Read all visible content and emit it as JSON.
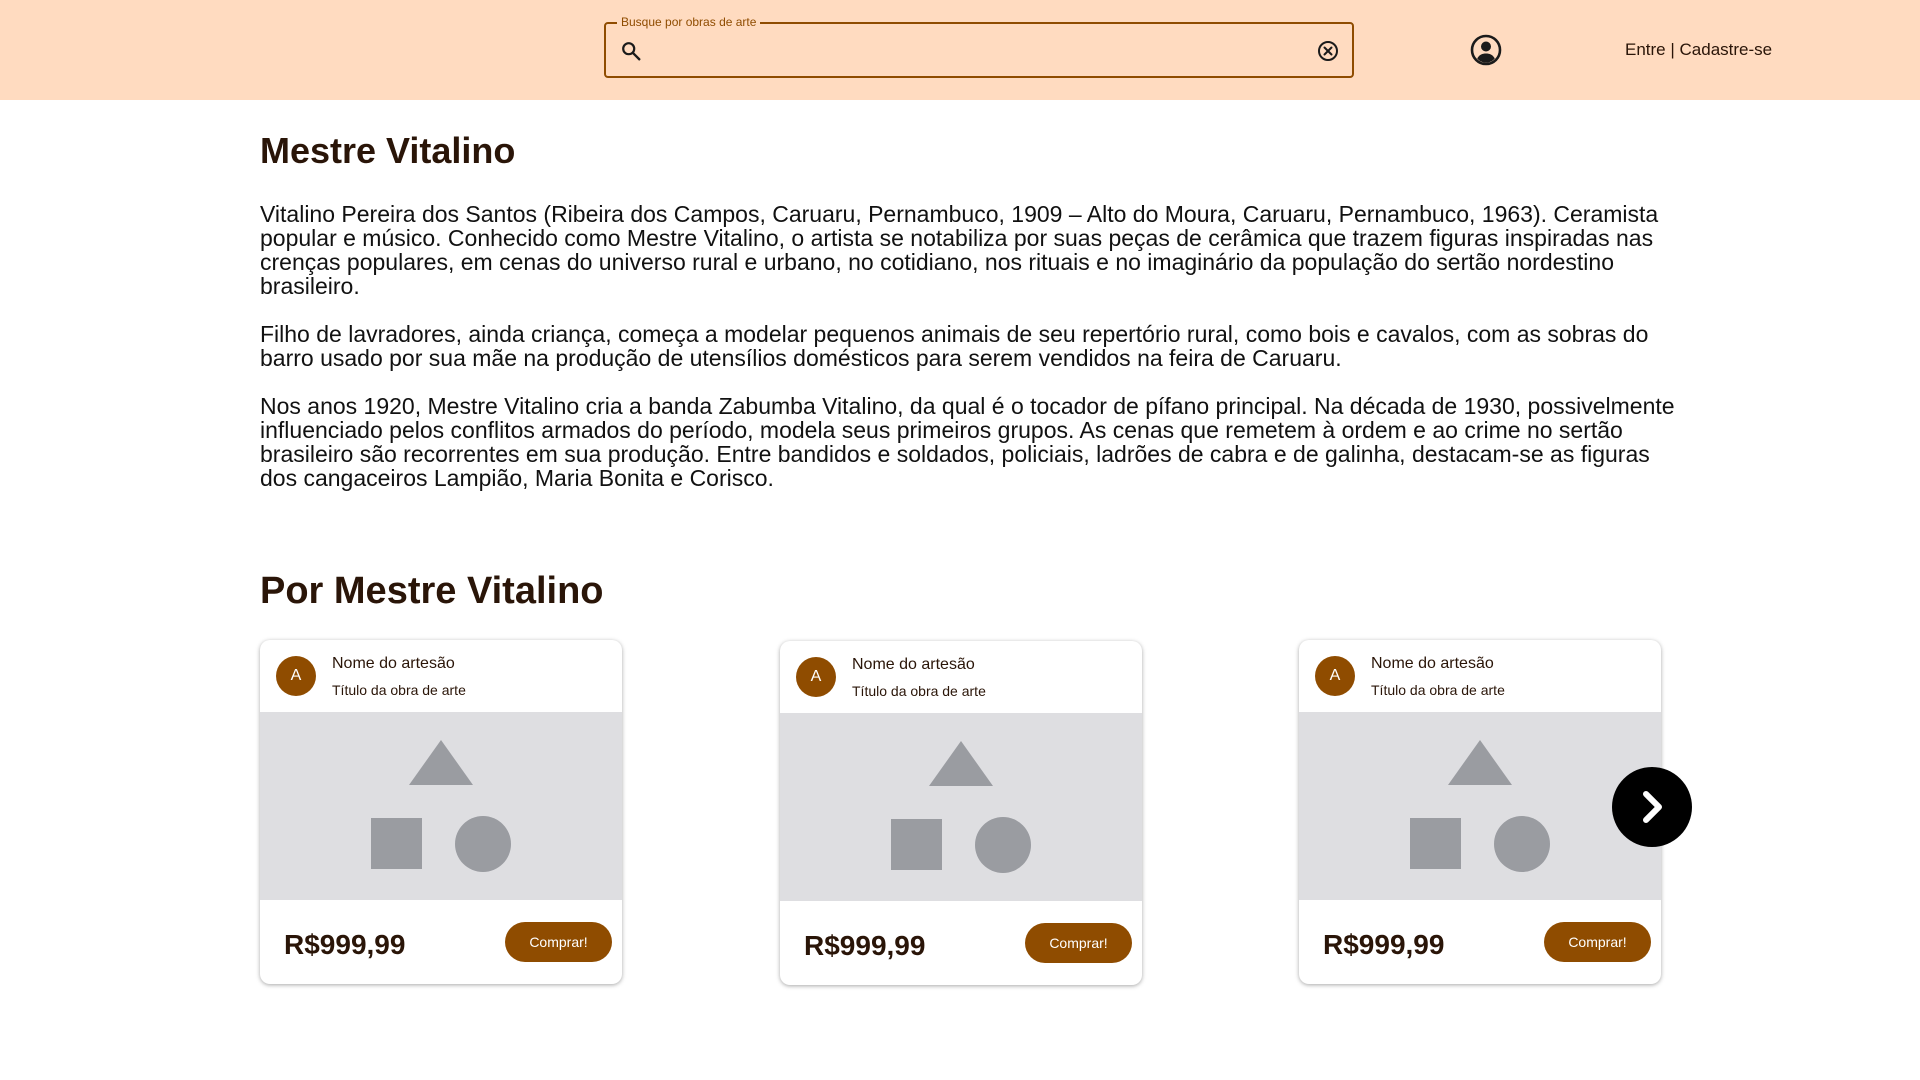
{
  "header": {
    "search": {
      "label": "Busque por obras de arte",
      "value": ""
    },
    "auth": {
      "login": "Entre",
      "separator": "|",
      "signup": "Cadastre-se"
    }
  },
  "artist": {
    "name": "Mestre Vitalino",
    "bio": [
      "Vitalino Pereira dos Santos (Ribeira dos Campos, Caruaru, Pernambuco, 1909 – Alto do Moura, Caruaru, Pernambuco, 1963). Ceramista popular e músico. Conhecido como Mestre Vitalino, o artista se notabiliza por suas peças de cerâmica que trazem figuras inspiradas nas crenças populares, em cenas do universo rural e urbano, no cotidiano, nos rituais e no imaginário da população do sertão nordestino brasileiro.",
      "Filho de lavradores, ainda criança, começa a modelar pequenos animais de seu repertório rural, como bois e cavalos, com as sobras do barro usado por sua mãe na produção de utensílios domésticos para serem vendidos na feira de Caruaru.",
      "Nos anos 1920, Mestre Vitalino cria a banda Zabumba Vitalino, da qual é o tocador de pífano principal. Na década de 1930, possivelmente influenciado pelos conflitos armados do período, modela seus primeiros grupos. As cenas que remetem à ordem e ao crime no sertão brasileiro são recorrentes em sua produção. Entre bandidos e soldados, policiais, ladrões de cabra e de galinha, destacam-se as figuras dos cangaceiros Lampião, Maria Bonita e Corisco."
    ]
  },
  "works_section": {
    "title": "Por Mestre Vitalino",
    "cards": [
      {
        "avatar": "A",
        "artisan": "Nome do artesão",
        "title": "Título da obra de arte",
        "price": "R$999,99",
        "button": "Comprar!"
      },
      {
        "avatar": "A",
        "artisan": "Nome do artesão",
        "title": "Título da obra de arte",
        "price": "R$999,99",
        "button": "Comprar!"
      },
      {
        "avatar": "A",
        "artisan": "Nome do artesão",
        "title": "Título da obra de arte",
        "price": "R$999,99",
        "button": "Comprar!"
      }
    ]
  },
  "colors": {
    "header_bg": "#ffdbc0",
    "accent": "#8f4c00",
    "text_dark": "#2a1508",
    "placeholder_bg": "#dedee1",
    "placeholder_shape": "#9a9ca1"
  },
  "icons": {
    "search": "search-icon",
    "clear": "clear-icon",
    "account": "account-circle-icon",
    "next": "chevron-right-icon",
    "image_placeholder": "shapes-placeholder-icon"
  }
}
